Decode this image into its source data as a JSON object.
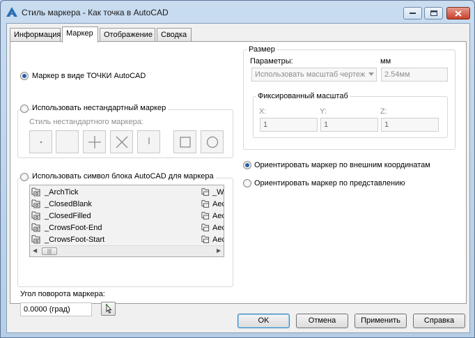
{
  "window": {
    "title": "Стиль маркера - Как точка в AutoCAD",
    "icon": "autocad-a-icon"
  },
  "tabs": [
    {
      "label": "Информация",
      "active": false
    },
    {
      "label": "Маркер",
      "active": true
    },
    {
      "label": "Отображение",
      "active": false
    },
    {
      "label": "Сводка",
      "active": false
    }
  ],
  "marker": {
    "option_point": "Маркер в виде ТОЧКИ AutoCAD",
    "option_custom": "Использовать нестандартный маркер",
    "custom_style_label": "Стиль нестандартного маркера:",
    "custom_shapes": [
      "dot-icon",
      "blank-icon",
      "plus-icon",
      "cross-icon",
      "tick-icon",
      "square-icon",
      "circle-icon"
    ],
    "option_block": "Использовать символ блока AutoCAD для маркера",
    "blocks_col1": [
      "_ArchTick",
      "_ClosedBlank",
      "_ClosedFilled",
      "_CrowsFoot-End",
      "_CrowsFoot-Start"
    ],
    "blocks_col2": [
      "_W",
      "Aec",
      "Aec",
      "Aec",
      "Aec"
    ],
    "scroll_thumb": "|||",
    "rotation_label": "Угол поворота маркера:",
    "rotation_value": "0.0000 (град)"
  },
  "size": {
    "group_label": "Размер",
    "params_label": "Параметры:",
    "units_label": "мм",
    "params_value": "Использовать масштаб чертеж",
    "size_value": "2.54мм",
    "fixed_scale_label": "Фиксированный масштаб",
    "x_label": "X:",
    "y_label": "Y:",
    "z_label": "Z:",
    "x_value": "1",
    "y_value": "1",
    "z_value": "1"
  },
  "orientation": {
    "option_world": "Ориентировать маркер по внешним координатам",
    "option_view": "Ориентировать маркер по представлению"
  },
  "buttons": {
    "ok": "OK",
    "cancel": "Отмена",
    "apply": "Применить",
    "help": "Справка"
  },
  "colors": {
    "selected_radio": "#2a5fa8",
    "title_bar": "#c9dcf0",
    "close_button": "#c9402a"
  }
}
